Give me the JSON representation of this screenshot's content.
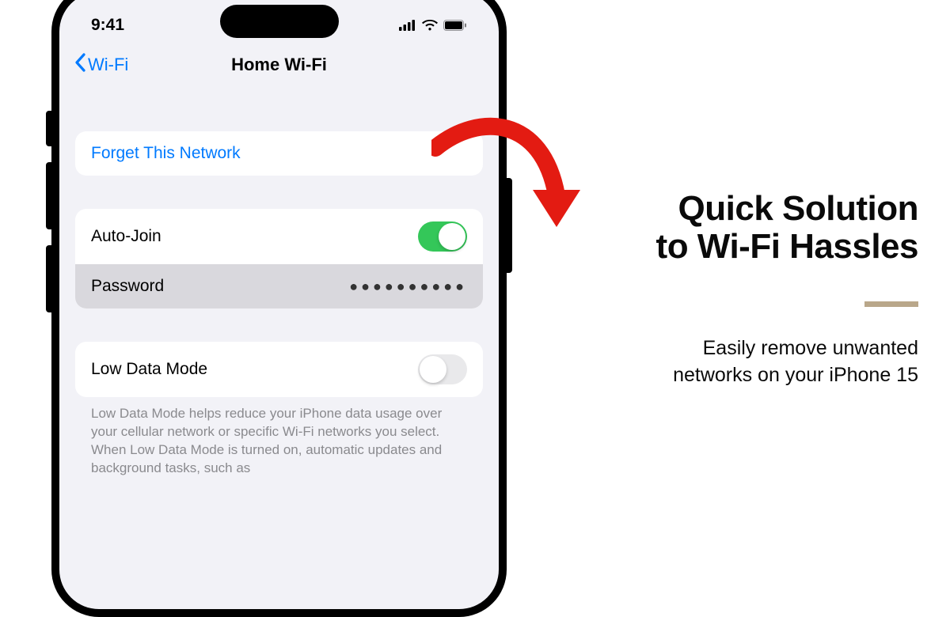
{
  "status": {
    "time": "9:41"
  },
  "nav": {
    "back_label": "Wi-Fi",
    "title": "Home Wi-Fi"
  },
  "forget": {
    "label": "Forget This Network"
  },
  "auto_join": {
    "label": "Auto-Join",
    "on": true
  },
  "password": {
    "label": "Password",
    "mask": "●●●●●●●●●●"
  },
  "low_data": {
    "label": "Low Data Mode",
    "on": false,
    "footer": "Low Data Mode helps reduce your iPhone data usage over your cellular network or specific Wi-Fi networks you select. When Low Data Mode is turned on, automatic updates and background tasks, such as"
  },
  "promo": {
    "headline_line1": "Quick Solution",
    "headline_line2": "to Wi-Fi Hassles",
    "sub_line1": "Easily remove unwanted",
    "sub_line2": "networks on your iPhone 15"
  },
  "colors": {
    "ios_blue": "#007aff",
    "ios_green": "#34c759",
    "arrow_red": "#e31b12",
    "accent_gold": "#b9a78a"
  }
}
